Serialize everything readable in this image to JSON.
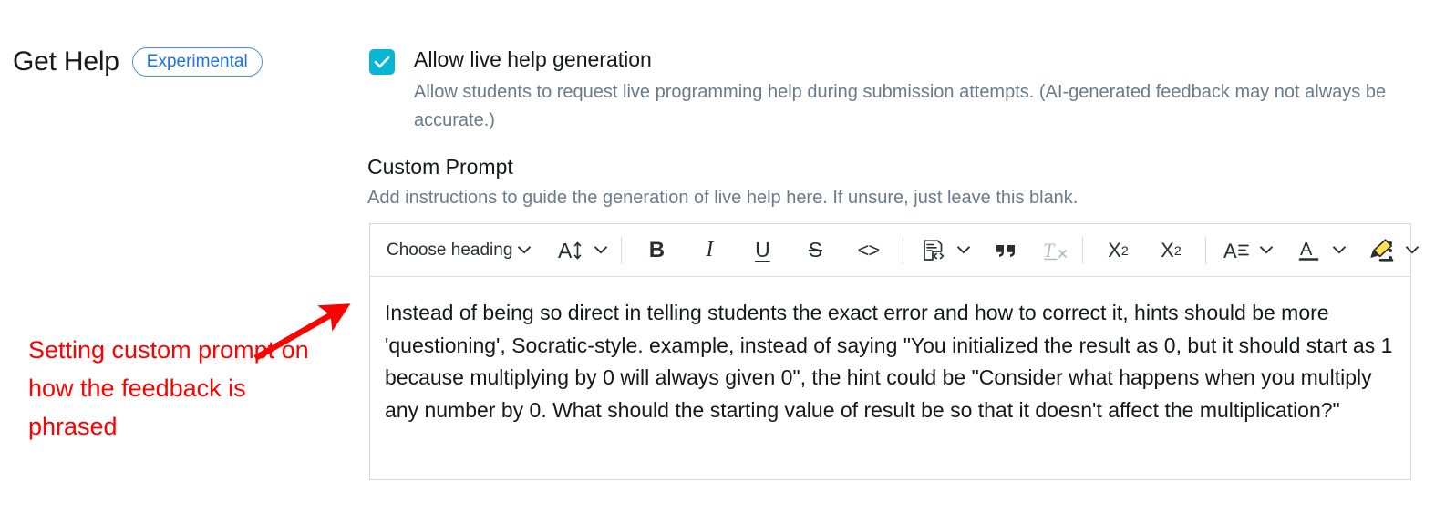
{
  "section": {
    "title": "Get Help",
    "badge": "Experimental"
  },
  "annotation": {
    "text": "Setting custom prompt on how the feedback is phrased",
    "color": "#fe0000",
    "arrow_icon": "arrow-up-right-icon"
  },
  "live_help": {
    "checked": true,
    "checkbox_icon": "checkmark-icon",
    "checkbox_color": "#06b6d4",
    "label": "Allow live help generation",
    "description": "Allow students to request live programming help during submission attempts. (AI-generated feedback may not always be accurate.)"
  },
  "custom_prompt": {
    "title": "Custom Prompt",
    "help_text": "Add instructions to guide the generation of live help here. If unsure, just leave this blank.",
    "editor": {
      "toolbar": {
        "heading_select": {
          "label": "Choose heading",
          "chevron_icon": "chevron-down-icon"
        },
        "font_size": {
          "icon": "font-size-icon",
          "glyph": "A",
          "chevron_icon": "chevron-down-icon"
        },
        "bold": {
          "icon": "bold-icon",
          "glyph": "B"
        },
        "italic": {
          "icon": "italic-icon",
          "glyph": "I"
        },
        "underline": {
          "icon": "underline-icon",
          "glyph": "U"
        },
        "strikethrough": {
          "icon": "strikethrough-icon",
          "glyph": "S"
        },
        "inline_code": {
          "icon": "code-icon",
          "glyph": "<>"
        },
        "code_block": {
          "icon": "code-block-icon",
          "chevron_icon": "chevron-down-icon"
        },
        "blockquote": {
          "icon": "blockquote-icon",
          "glyph": "“"
        },
        "clear_formatting": {
          "icon": "clear-formatting-icon",
          "glyph": "T",
          "sub": "x",
          "disabled": true
        },
        "subscript": {
          "icon": "subscript-icon",
          "glyph": "X",
          "sub": "2"
        },
        "superscript": {
          "icon": "superscript-icon",
          "glyph": "X",
          "sup": "2"
        },
        "align": {
          "icon": "text-align-icon",
          "glyph": "A",
          "chevron_icon": "chevron-down-icon"
        },
        "font_color": {
          "icon": "font-color-icon",
          "glyph": "A",
          "chevron_icon": "chevron-down-icon"
        },
        "highlight": {
          "icon": "highlighter-icon",
          "color": "#ffe14d",
          "chevron_icon": "chevron-down-icon"
        },
        "more_options": {
          "icon": "more-vertical-icon"
        }
      },
      "content": "Instead of being so direct in telling students the exact error and how to correct it, hints should be more 'questioning', Socratic-style. example, instead of saying \"You initialized the result as 0, but it should start as 1 because multiplying by 0 will always given 0\", the hint could be \"Consider what happens when you multiply any number by 0. What should the starting value of result be so that it doesn't affect the multiplication?\"",
      "placeholder": "Add instructions to guide the generation of live help here."
    }
  }
}
